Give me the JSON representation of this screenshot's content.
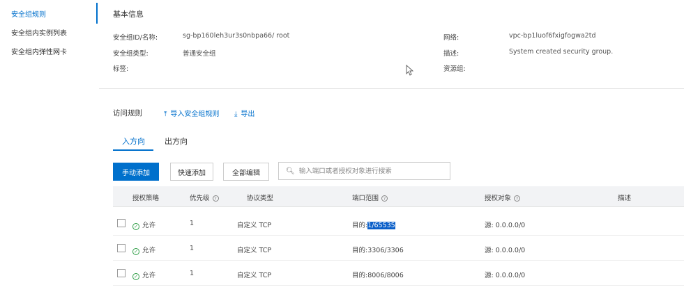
{
  "sidebar": {
    "items": [
      {
        "label": "安全组规则"
      },
      {
        "label": "安全组内实例列表"
      },
      {
        "label": "安全组内弹性网卡"
      }
    ]
  },
  "basic_info": {
    "title": "基本信息",
    "id_label": "安全组ID/名称:",
    "id_value": "sg-bp160leh3ur3s0nbpa66/ root",
    "vpc_label": "网络:",
    "vpc_value": "vpc-bp1luof6fxigfogwa2td",
    "type_label": "安全组类型:",
    "type_value": "普通安全组",
    "desc_label": "描述:",
    "desc_value": "System created security group.",
    "tag_label": "标签:",
    "rg_label": "资源组:"
  },
  "rules": {
    "title": "访问规则",
    "import_label": "导入安全组规则",
    "export_label": "导出",
    "tabs": [
      {
        "label": "入方向"
      },
      {
        "label": "出方向"
      }
    ],
    "buttons": {
      "manual_add": "手动添加",
      "quick_add": "快速添加",
      "all_edit": "全部编辑"
    },
    "search_placeholder": "输入端口或者授权对象进行搜索",
    "columns": [
      "授权策略",
      "优先级",
      "协议类型",
      "端口范围",
      "授权对象",
      "描述"
    ],
    "rows": [
      {
        "policy": "允许",
        "priority": "1",
        "protocol": "自定义 TCP",
        "port_prefix": "目的:",
        "port_value": "1/65535",
        "source": "源: 0.0.0.0/0"
      },
      {
        "policy": "允许",
        "priority": "1",
        "protocol": "自定义 TCP",
        "port_prefix": "目的:",
        "port_value": "3306/3306",
        "source": "源: 0.0.0.0/0"
      },
      {
        "policy": "允许",
        "priority": "1",
        "protocol": "自定义 TCP",
        "port_prefix": "目的:",
        "port_value": "8006/8006",
        "source": "源: 0.0.0.0/0"
      }
    ]
  },
  "colors": {
    "accent": "#0070cc",
    "allow_green": "#2e9e46",
    "table_header_bg": "#f2f3f5"
  }
}
